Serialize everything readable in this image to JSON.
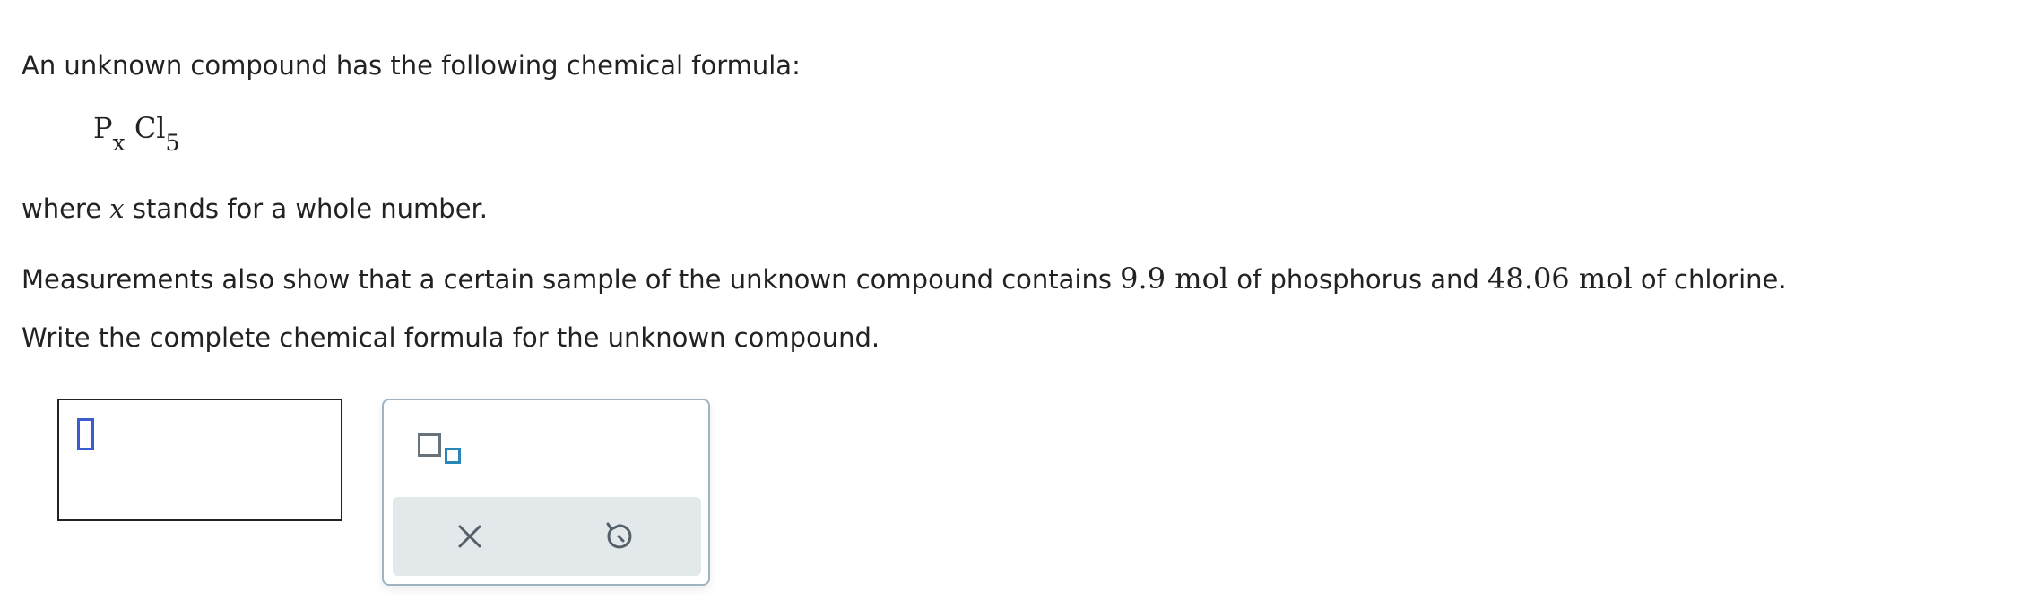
{
  "question": {
    "intro": "An unknown compound has the following chemical formula:",
    "formula": {
      "element1": "P",
      "sub1": "x",
      "element2": "Cl",
      "sub2": "5"
    },
    "where_prefix": "where ",
    "where_var": "x",
    "where_suffix": " stands for a whole number.",
    "measure_part1": "Measurements also show that a certain sample of the unknown compound contains ",
    "phosphorus_amount": "9.9 mol",
    "measure_part2": " of phosphorus and ",
    "chlorine_amount": "48.06 mol",
    "measure_part3": " of chlorine.",
    "instruction": "Write the complete chemical formula for the unknown compound."
  },
  "palette": {
    "subscript_icon": "subscript-template-icon",
    "clear_icon": "x-icon",
    "reset_icon": "undo-icon"
  },
  "colors": {
    "cursor_box": "#3b5ccc",
    "subscript_small_box": "#2a85b8",
    "action_bar_bg": "#e3e8eb",
    "icon_gray": "#55606a"
  }
}
